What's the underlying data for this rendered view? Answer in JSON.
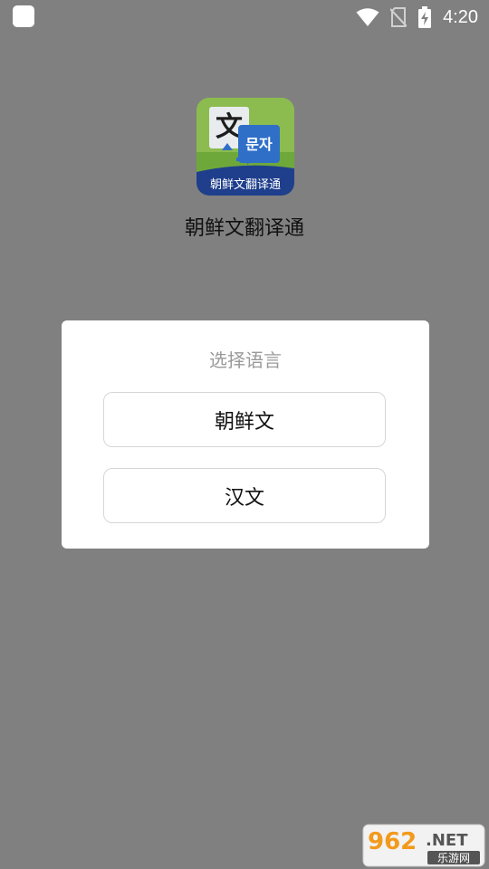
{
  "status_bar": {
    "time": "4:20",
    "icons": [
      "app-notification-icon",
      "wifi-icon",
      "no-sim-icon",
      "battery-charging-icon"
    ]
  },
  "app": {
    "name": "朝鲜文翻译通",
    "icon": {
      "top_glyph": "文",
      "korean_glyph": "문자",
      "banner_text": "朝鲜文翻译通"
    }
  },
  "dialog": {
    "title": "选择语言",
    "options": [
      {
        "label": "朝鲜文"
      },
      {
        "label": "汉文"
      }
    ]
  },
  "watermark": {
    "brand_main": "962",
    "brand_suffix": ".NET",
    "brand_sub": "乐游网"
  },
  "colors": {
    "overlay_background": "#808080",
    "dialog_background": "#ffffff",
    "dialog_title": "#9a9a9a",
    "icon_green": "#6fa83a",
    "icon_navy": "#1f3f8c",
    "icon_blue": "#2f6fc8"
  }
}
